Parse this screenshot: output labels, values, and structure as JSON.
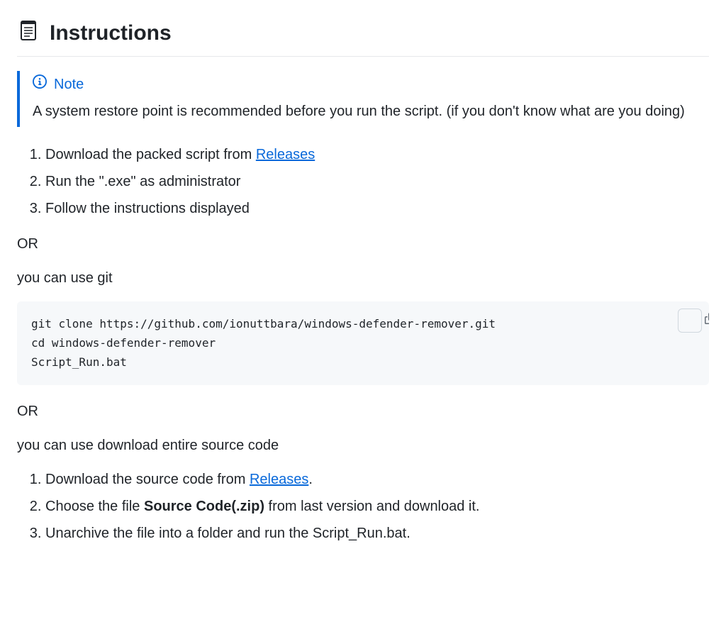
{
  "heading": "Instructions",
  "note": {
    "label": "Note",
    "body": "A system restore point is recommended before you run the script. (if you don't know what are you doing)"
  },
  "list1": {
    "item1_a": "Download the packed script from ",
    "item1_link": "Releases",
    "item2": "Run the \".exe\" as administrator",
    "item3": "Follow the instructions displayed"
  },
  "or1": "OR",
  "git_intro": "you can use git",
  "code": "git clone https://github.com/ionuttbara/windows-defender-remover.git\ncd windows-defender-remover\nScript_Run.bat",
  "or2": "OR",
  "src_intro": "you can use download entire source code",
  "list2": {
    "item1_a": "Download the source code from ",
    "item1_link": "Releases",
    "item1_b": ".",
    "item2_a": "Choose the file ",
    "item2_strong": "Source Code(.zip)",
    "item2_b": " from last version and download it.",
    "item3": "Unarchive the file into a folder and run the Script_Run.bat."
  }
}
